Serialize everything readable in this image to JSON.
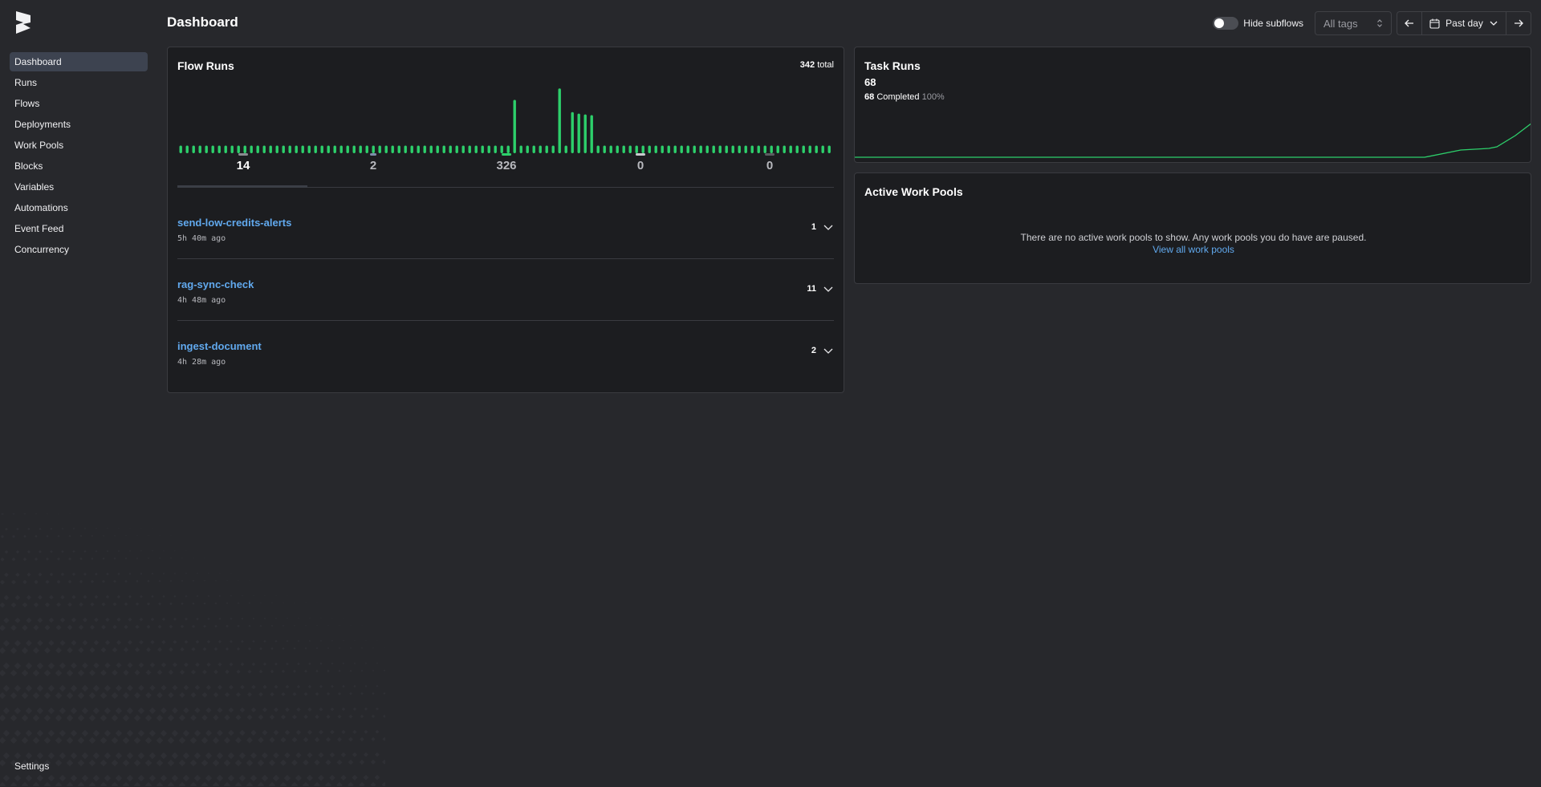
{
  "page": {
    "title": "Dashboard"
  },
  "sidebar": {
    "items": [
      {
        "label": "Dashboard",
        "active": true
      },
      {
        "label": "Runs"
      },
      {
        "label": "Flows"
      },
      {
        "label": "Deployments"
      },
      {
        "label": "Work Pools"
      },
      {
        "label": "Blocks"
      },
      {
        "label": "Variables"
      },
      {
        "label": "Automations"
      },
      {
        "label": "Event Feed"
      },
      {
        "label": "Concurrency"
      }
    ],
    "settings_label": "Settings"
  },
  "toolbar": {
    "hide_subflows_label": "Hide subflows",
    "hide_subflows_on": false,
    "tags_placeholder": "All tags",
    "range_label": "Past day"
  },
  "flow_runs": {
    "title": "Flow Runs",
    "total_count": "342",
    "total_suffix": "total",
    "bar_heights": [
      1,
      1,
      1,
      1,
      1,
      1,
      1,
      1,
      1,
      1,
      1,
      1,
      1,
      1,
      1,
      1,
      1,
      1,
      1,
      1,
      1,
      1,
      1,
      1,
      1,
      1,
      1,
      1,
      1,
      1,
      1,
      1,
      1,
      1,
      1,
      1,
      1,
      1,
      1,
      1,
      1,
      1,
      1,
      1,
      1,
      1,
      1,
      1,
      1,
      1,
      1,
      1,
      1,
      1,
      1,
      1,
      1,
      1,
      1,
      1,
      1,
      1,
      1,
      1,
      1,
      1,
      1,
      1,
      1,
      1,
      1,
      1,
      1,
      1,
      1,
      1,
      1,
      1,
      1,
      1,
      1,
      1,
      1,
      1,
      1,
      1,
      1,
      1,
      1,
      1,
      1,
      1,
      1,
      1,
      1,
      1,
      1,
      1,
      1,
      1,
      1,
      1
    ],
    "stats": [
      {
        "value": "14",
        "color": "#8a8b90",
        "selected": true
      },
      {
        "value": "2",
        "color": "#7f8eaa"
      },
      {
        "value": "326",
        "color": "#2dd06b"
      },
      {
        "value": "0",
        "color": "#c9cace"
      },
      {
        "value": "0",
        "color": "#5b5c61"
      }
    ],
    "rows": [
      {
        "name": "send-low-credits-alerts",
        "time": "5h 40m ago",
        "count": "1"
      },
      {
        "name": "rag-sync-check",
        "time": "4h 48m ago",
        "count": "11"
      },
      {
        "name": "ingest-document",
        "time": "4h 28m ago",
        "count": "2"
      }
    ]
  },
  "task_runs": {
    "title": "Task Runs",
    "total": "68",
    "completed_count": "68",
    "completed_label": "Completed",
    "completed_pct": "100%"
  },
  "work_pools": {
    "title": "Active Work Pools",
    "empty_message": "There are no active work pools to show. Any work pools you do have are paused.",
    "link_label": "View all work pools"
  },
  "colors": {
    "accent": "#61a9ee",
    "success": "#2dd06b",
    "active_nav": "#3d4350"
  }
}
